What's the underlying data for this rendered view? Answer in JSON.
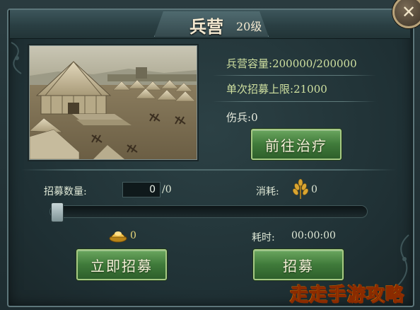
{
  "window": {
    "title": "兵营",
    "level": "20级"
  },
  "stats": {
    "capacity_label": "兵营容量:",
    "capacity_value": "200000/200000",
    "limit_label": "单次招募上限:",
    "limit_value": "21000",
    "wounded_label": "伤兵:",
    "wounded_value": "0"
  },
  "buttons": {
    "heal": "前往治疗",
    "instant_recruit": "立即招募",
    "recruit": "招募",
    "close": "✕"
  },
  "recruit": {
    "count_label": "招募数量:",
    "count_value": "0",
    "count_max": "/0",
    "cost_label": "消耗:",
    "cost_value": "0",
    "gold_value": "0",
    "time_label": "耗时:",
    "time_value": "00:00:00",
    "slider_fraction": 0
  },
  "icons": {
    "wheat": "wheat-icon",
    "gold": "gold-ingot-icon",
    "close": "close-icon"
  },
  "watermark": "走走手游攻略",
  "colors": {
    "panel_bg": "#1f3034",
    "label_green": "#cfe0a0",
    "button_green": "#3f7a3a",
    "watermark_yellow": "#ffe300"
  }
}
